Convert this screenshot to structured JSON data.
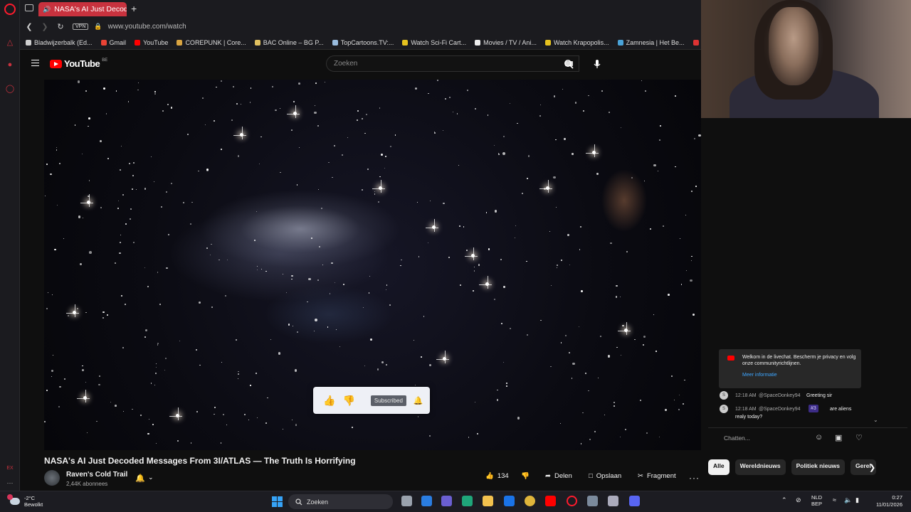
{
  "browser": {
    "tab_title": "NASA's AI Just Decoded",
    "url": "www.youtube.com/watch",
    "vpn_label": "VPN",
    "bookmarks": [
      {
        "label": "Bladwijzerbalk (Ed...",
        "color": "#cfcfcf"
      },
      {
        "label": "Gmail",
        "color": "#ea4335"
      },
      {
        "label": "YouTube",
        "color": "#ff0000"
      },
      {
        "label": "COREPUNK | Core...",
        "color": "#d9a441"
      },
      {
        "label": "BAC Online – BG P...",
        "color": "#e0c060"
      },
      {
        "label": "TopCartoons.TV:...",
        "color": "#9bd"
      },
      {
        "label": "Watch Sci-Fi Cart...",
        "color": "#e6c21f"
      },
      {
        "label": "Movies / TV / Ani...",
        "color": "#eeeeee"
      },
      {
        "label": "Watch Krapopolis...",
        "color": "#e6c21f"
      },
      {
        "label": "Zamnesia | Het Be...",
        "color": "#4aa3d8"
      },
      {
        "label": "EM",
        "color": "#d33"
      }
    ],
    "sidebar_labels": [
      "EX"
    ]
  },
  "youtube": {
    "logo_text": "YouTube",
    "region": "BE",
    "search_placeholder": "Zoeken"
  },
  "video": {
    "title": "NASA's AI Just Decoded Messages From 3I/ATLAS — The Truth Is Horrifying",
    "overlay_subscribed": "Subscribed"
  },
  "channel": {
    "name": "Raven's Cold Trail",
    "subscribers": "2,44K abonnees"
  },
  "actions": {
    "likes": "134",
    "share": "Delen",
    "save": "Opslaan",
    "clip": "Fragment"
  },
  "chat": {
    "notice_text": "Welkom in de livechat. Bescherm je privacy en volg onze communityrichtlijnen.",
    "notice_link": "Meer informatie",
    "messages": [
      {
        "time": "12:18 AM",
        "user": "@SpaceDonkey94",
        "text": "Greeting sir"
      },
      {
        "time": "12:18 AM",
        "user": "@SpaceDonkey94",
        "badge": "#3",
        "text": "are aliens",
        "text_line2": "realy today?"
      }
    ],
    "input_placeholder": "Chatten...",
    "chips": [
      "Alle",
      "Wereldnieuws",
      "Politiek nieuws",
      "Gerel"
    ]
  },
  "taskbar": {
    "temperature": "-2°C",
    "weather": "Bewolkt",
    "search_label": "Zoeken",
    "lang": "NLD",
    "kbd_layout": "BEP",
    "time": "0:27",
    "date": "11/01/2026"
  }
}
